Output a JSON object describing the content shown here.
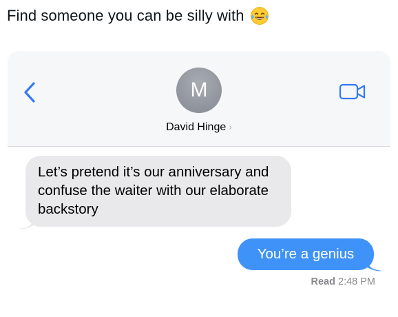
{
  "caption": {
    "text": "Find someone you can be silly with",
    "emoji": "face-with-tears-of-joy-icon"
  },
  "header": {
    "avatar_initial": "M",
    "contact_name": "David Hinge",
    "chevron": "›",
    "icons": {
      "back": "back-chevron-icon",
      "video": "video-call-icon"
    },
    "accent": "#3478f6"
  },
  "messages": [
    {
      "direction": "incoming",
      "text": "Let’s pretend it’s our anniversary and confuse the waiter with our elaborate backstory",
      "color": "#e9e9eb"
    },
    {
      "direction": "outgoing",
      "text": "You’re a genius",
      "color": "#3f93f8"
    }
  ],
  "receipt": {
    "status": "Read",
    "time": "2:48 PM"
  }
}
